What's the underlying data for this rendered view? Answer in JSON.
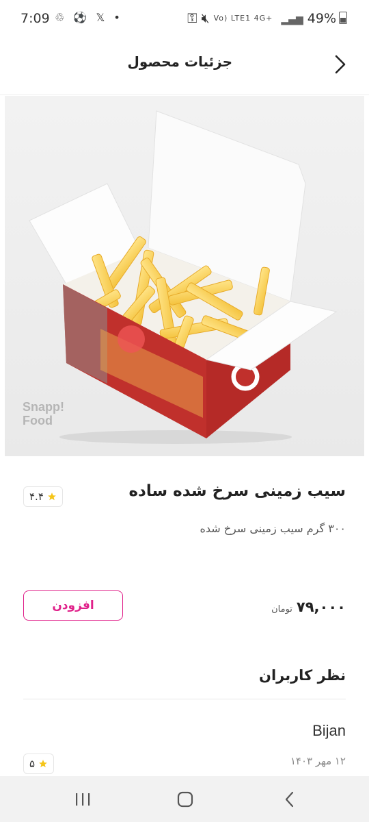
{
  "status_bar": {
    "time": "7:09",
    "left_icons": "♲ ⚽ 𝕏 •",
    "network_label": "Vo) LTE1 4G+",
    "battery": "49%"
  },
  "header": {
    "title": "جزئیات محصول"
  },
  "product": {
    "watermark_line1": "Snapp!",
    "watermark_line2": "Food",
    "name": "سیب زمینی سرخ شده ساده",
    "description": "۳۰۰ گرم سیب زمینی سرخ شده",
    "rating": "۴.۴",
    "price": "۷۹,۰۰۰",
    "price_unit": "تومان",
    "add_label": "افزودن"
  },
  "reviews": {
    "title": "نظر کاربران",
    "items": [
      {
        "name": "Bijan",
        "date": "۱۲ مهر ۱۴۰۳",
        "rating": "۵"
      }
    ]
  },
  "colors": {
    "accent": "#e0218a",
    "star": "#f5c518"
  }
}
